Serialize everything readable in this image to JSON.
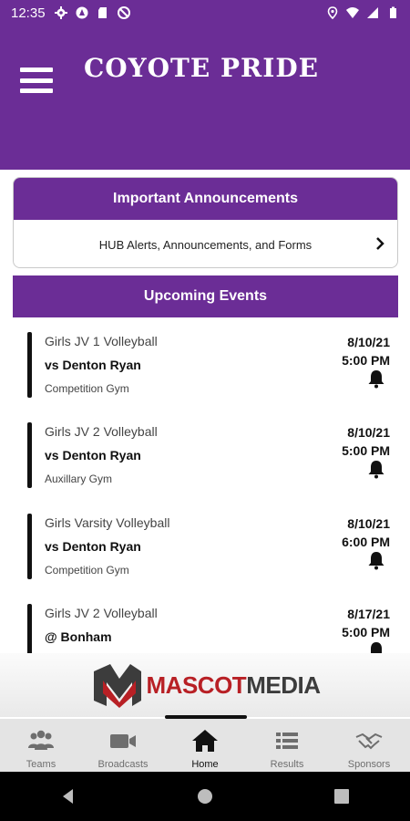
{
  "status_bar": {
    "time": "12:35"
  },
  "header": {
    "title": "COYOTE PRIDE"
  },
  "announcements": {
    "title": "Important Announcements",
    "row_label": "HUB Alerts, Announcements, and Forms"
  },
  "upcoming": {
    "title": "Upcoming Events",
    "events": [
      {
        "sport": "Girls JV 1 Volleyball",
        "opponent": "vs Denton Ryan",
        "location": "Competition Gym",
        "date": "8/10/21",
        "time": "5:00 PM"
      },
      {
        "sport": "Girls JV 2 Volleyball",
        "opponent": "vs Denton Ryan",
        "location": "Auxillary Gym",
        "date": "8/10/21",
        "time": "5:00 PM"
      },
      {
        "sport": "Girls Varsity Volleyball",
        "opponent": "vs Denton Ryan",
        "location": "Competition Gym",
        "date": "8/10/21",
        "time": "6:00 PM"
      },
      {
        "sport": "Girls JV 2 Volleyball",
        "opponent": "@ Bonham",
        "location": "",
        "date": "8/17/21",
        "time": "5:00 PM"
      }
    ]
  },
  "sponsor": {
    "name_part1": "MASCOT",
    "name_part2": "MEDIA"
  },
  "bottom_nav": {
    "items": [
      {
        "label": "Teams",
        "icon": "teams-icon"
      },
      {
        "label": "Broadcasts",
        "icon": "video-camera-icon"
      },
      {
        "label": "Home",
        "icon": "home-icon"
      },
      {
        "label": "Results",
        "icon": "list-icon"
      },
      {
        "label": "Sponsors",
        "icon": "handshake-icon"
      }
    ],
    "active": "Home"
  },
  "colors": {
    "brand_purple": "#6b2d96",
    "sponsor_red": "#b82025"
  }
}
